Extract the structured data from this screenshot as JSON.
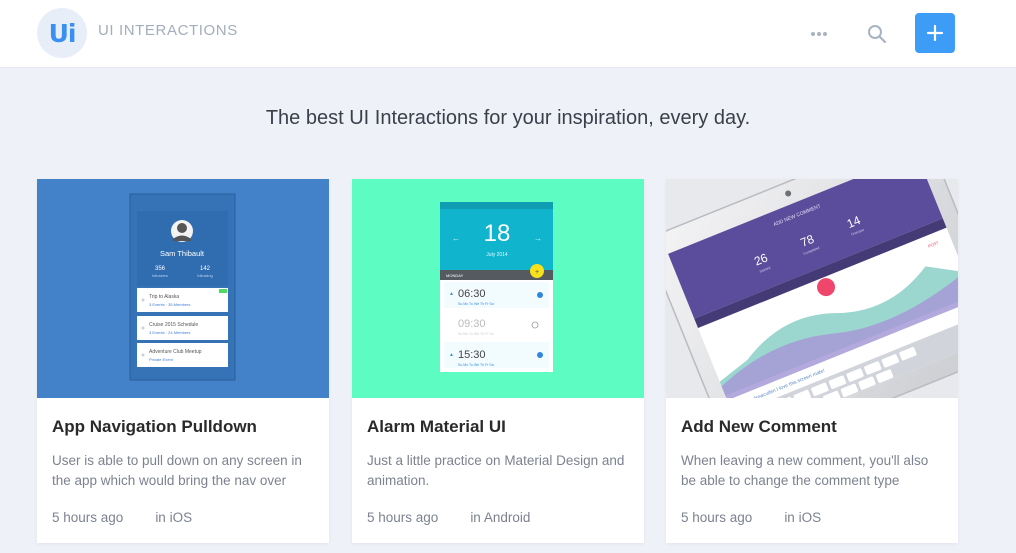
{
  "header": {
    "logo": "Ui",
    "brand": "UI INTERACTIONS",
    "more_icon": "more-dots-icon",
    "search_icon": "search-icon",
    "add_icon": "plus-icon",
    "accent": "#3d9cf5"
  },
  "tagline": "The best UI Interactions for your inspiration, every day.",
  "cards": [
    {
      "title": "App Navigation Pulldown",
      "description": "User is able to pull down on any screen in the app which would bring the nav over",
      "time": "5 hours ago",
      "platform": "in iOS",
      "thumb_color": "#4381c8",
      "thumb": {
        "profile_name": "Sam Thibault",
        "stats": [
          {
            "value": "356",
            "label": "followers"
          },
          {
            "value": "142",
            "label": "following"
          }
        ],
        "items": [
          {
            "title": "Trip to Alaska",
            "meta": "3 Events · 35 Members"
          },
          {
            "title": "Cruise 2015 Schedule",
            "meta": "3 Events · 24 Members"
          },
          {
            "title": "Adventure Club Meetup",
            "meta": "Private Event"
          }
        ]
      }
    },
    {
      "title": "Alarm Material UI",
      "description": "Just a little practice on Material Design and animation.",
      "time": "5 hours ago",
      "platform": "in Android",
      "thumb_color": "#5dfcc2",
      "thumb": {
        "day": "18",
        "month": "July 2014",
        "bar_label": "MONDAY",
        "alarms": [
          "06:30",
          "09:30",
          "15:30"
        ],
        "weekdays": "Su Mo Tu We Th Fr Sa"
      }
    },
    {
      "title": "Add New Comment",
      "description": "When leaving a new comment, you'll also be able to change the comment type",
      "time": "5 hours ago",
      "platform": "in iOS",
      "thumb_color": "#e8e9ec",
      "thumb": {
        "header": "ADD NEW COMMENT",
        "numbers": [
          "26",
          "78",
          "14"
        ],
        "number_labels": [
          "Started",
          "Completed",
          "Overdue"
        ],
        "comment": "@andrewcullen I love this screen mate!",
        "post": "POST"
      }
    }
  ]
}
